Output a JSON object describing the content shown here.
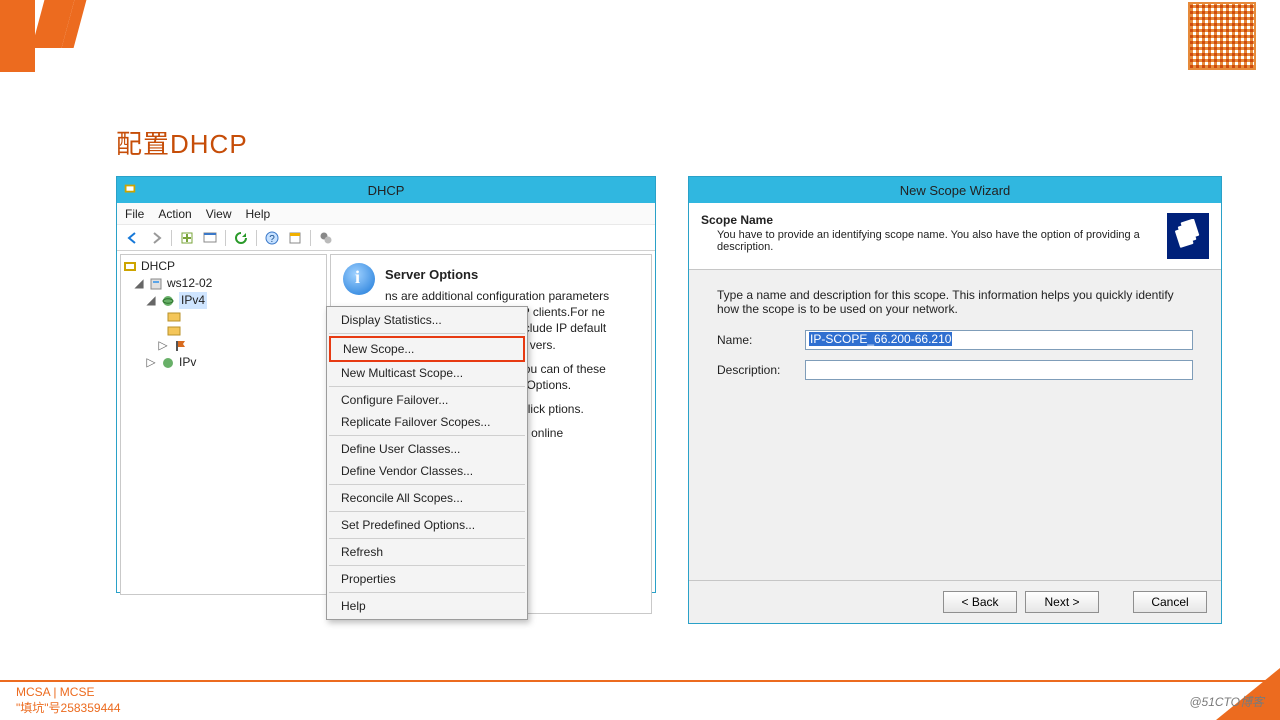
{
  "slide": {
    "title": "配置DHCP"
  },
  "dhcp": {
    "title": "DHCP",
    "menu": {
      "file": "File",
      "action": "Action",
      "view": "View",
      "help": "Help"
    },
    "tree": {
      "root": "DHCP",
      "server": "ws12-02",
      "ipv4": "IPv4",
      "ipv_cut": "IPv"
    },
    "content": {
      "heading": "Server Options",
      "p1": "ns are additional configuration parameters server can assign to DHCP clients.For ne commonly used options include IP default gateways (routers), WINS servers, vers.",
      "p2": "ns act as defaults for all scopes.  You can of these server options by defining the ope Options.",
      "p3": "rver options, on the Action menu, click ptions.",
      "p4": "ormation about server options, see online"
    },
    "context": {
      "display_stats": "Display Statistics...",
      "new_scope": "New Scope...",
      "new_mcast": "New Multicast Scope...",
      "conf_failover": "Configure Failover...",
      "repl_failover": "Replicate Failover Scopes...",
      "def_user": "Define User Classes...",
      "def_vendor": "Define Vendor Classes...",
      "reconcile": "Reconcile All Scopes...",
      "predef": "Set Predefined Options...",
      "refresh": "Refresh",
      "properties": "Properties",
      "help": "Help"
    }
  },
  "wizard": {
    "title": "New Scope Wizard",
    "scope_name": "Scope Name",
    "scope_desc": "You have to provide an identifying scope name. You also have the option of providing a description.",
    "instructions": "Type a name and description for this scope. This information helps you quickly identify how the scope is to be used on your network.",
    "name_label": "Name:",
    "name_value": "IP-SCOPE_66.200-66.210",
    "desc_label": "Description:",
    "desc_value": "",
    "back": "< Back",
    "next": "Next >",
    "cancel": "Cancel"
  },
  "footer": {
    "line1": "MCSA | MCSE",
    "line2": "\"填坑\"号258359444",
    "watermark": "@51CTO博客"
  }
}
